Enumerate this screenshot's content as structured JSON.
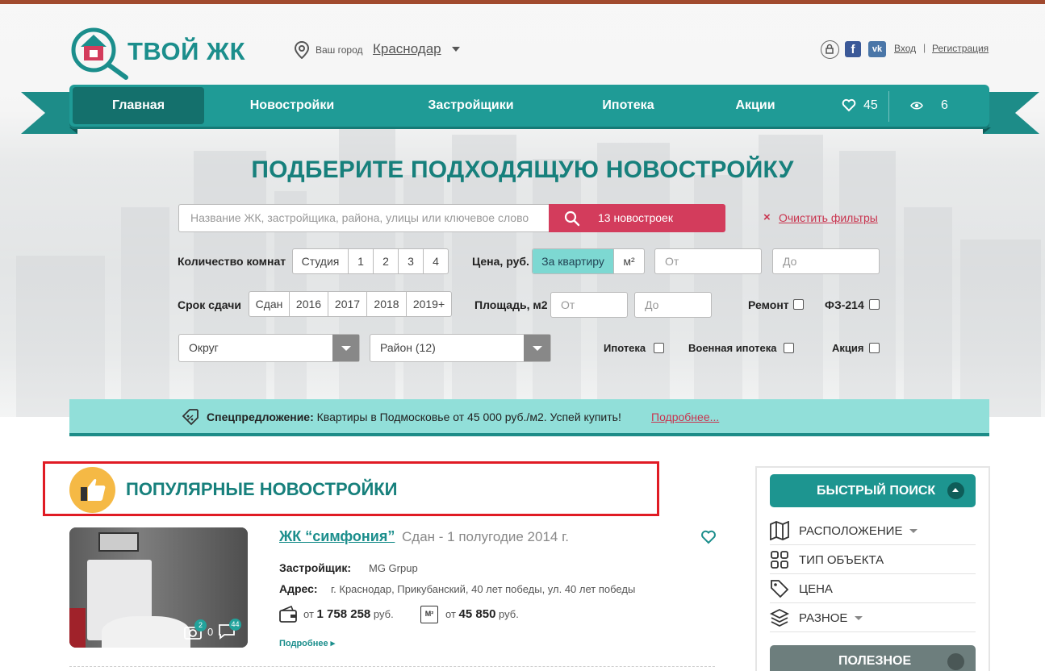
{
  "header": {
    "logo_text": "ТВОЙ ЖК",
    "city_label": "Ваш город",
    "city_value": "Краснодар",
    "fb_letter": "f",
    "vk_letter": "vk",
    "login": "Вход",
    "separator": "|",
    "register": "Регистрация"
  },
  "nav": {
    "items": [
      {
        "label": "Главная",
        "active": true
      },
      {
        "label": "Новостройки",
        "active": false
      },
      {
        "label": "Застройщики",
        "active": false
      },
      {
        "label": "Ипотека",
        "active": false
      },
      {
        "label": "Акции",
        "active": false
      }
    ],
    "favorites_count": "45",
    "views_count": "6"
  },
  "search": {
    "title": "ПОДБЕРИТЕ ПОДХОДЯЩУЮ НОВОСТРОЙКУ",
    "placeholder": "Название ЖК, застройщика, района, улицы или ключевое слово",
    "button_label": "13 новостроек",
    "clear_x": "×",
    "clear_label": "Очистить фильтры"
  },
  "filters": {
    "rooms_label": "Количество комнат",
    "rooms": [
      "Студия",
      "1",
      "2",
      "3",
      "4"
    ],
    "price_label": "Цена, руб.",
    "price_modes": [
      "За квартиру",
      "м²"
    ],
    "price_from": "От",
    "price_to": "До",
    "deadline_label": "Срок сдачи",
    "deadlines": [
      "Сдан",
      "2016",
      "2017",
      "2018",
      "2019+"
    ],
    "area_label": "Площадь, м2",
    "area_from": "От",
    "area_to": "До",
    "repair_label": "Ремонт",
    "fz_label": "ФЗ-214",
    "district_select": "Округ",
    "region_select": "Район (12)",
    "mortgage_label": "Ипотека",
    "military_label": "Военная ипотека",
    "promo_label": "Акция"
  },
  "promo": {
    "bold": "Спецпредложение:",
    "text": "Квартиры в Подмосковье от 45 000 руб./м2. Успей купить!",
    "link": "Подробнее..."
  },
  "popular": {
    "title": "ПОПУЛЯРНЫЕ НОВОСТРОЙКИ",
    "card": {
      "title": "ЖК “симфония”",
      "status": "Сдан - 1 полугодие 2014 г.",
      "developer_label": "Застройщик:",
      "developer": "MG Grpup",
      "address_label": "Адрес:",
      "address": "г. Краснодар, Прикубанский, 40 лет победы, ул. 40 лет победы",
      "price_prefix": "от",
      "price": "1 758 258",
      "price_unit": "руб.",
      "sqm_prefix": "от",
      "sqm_price": "45 850",
      "sqm_unit": "руб.",
      "sqm_icon_text": "М²",
      "photos_badge": "2",
      "photos_count": "0",
      "comments_badge": "44",
      "more": "Подробнее ▸"
    }
  },
  "sidebar": {
    "quick_search": "БЫСТРЫЙ ПОИСК",
    "items": [
      {
        "label": "РАСПОЛОЖЕНИЕ",
        "icon": "map-icon",
        "caret": true
      },
      {
        "label": "ТИП ОБЪЕКТА",
        "icon": "grid-icon",
        "caret": false
      },
      {
        "label": "ЦЕНА",
        "icon": "tag-icon",
        "caret": false
      },
      {
        "label": "РАЗНОЕ",
        "icon": "layers-icon",
        "caret": true
      }
    ],
    "useful": "ПОЛЕЗНОЕ"
  },
  "colors": {
    "accent": "#1f9b96",
    "accent_dark": "#14706c",
    "cta": "#d33c5c",
    "highlight_box": "#e01b24"
  }
}
